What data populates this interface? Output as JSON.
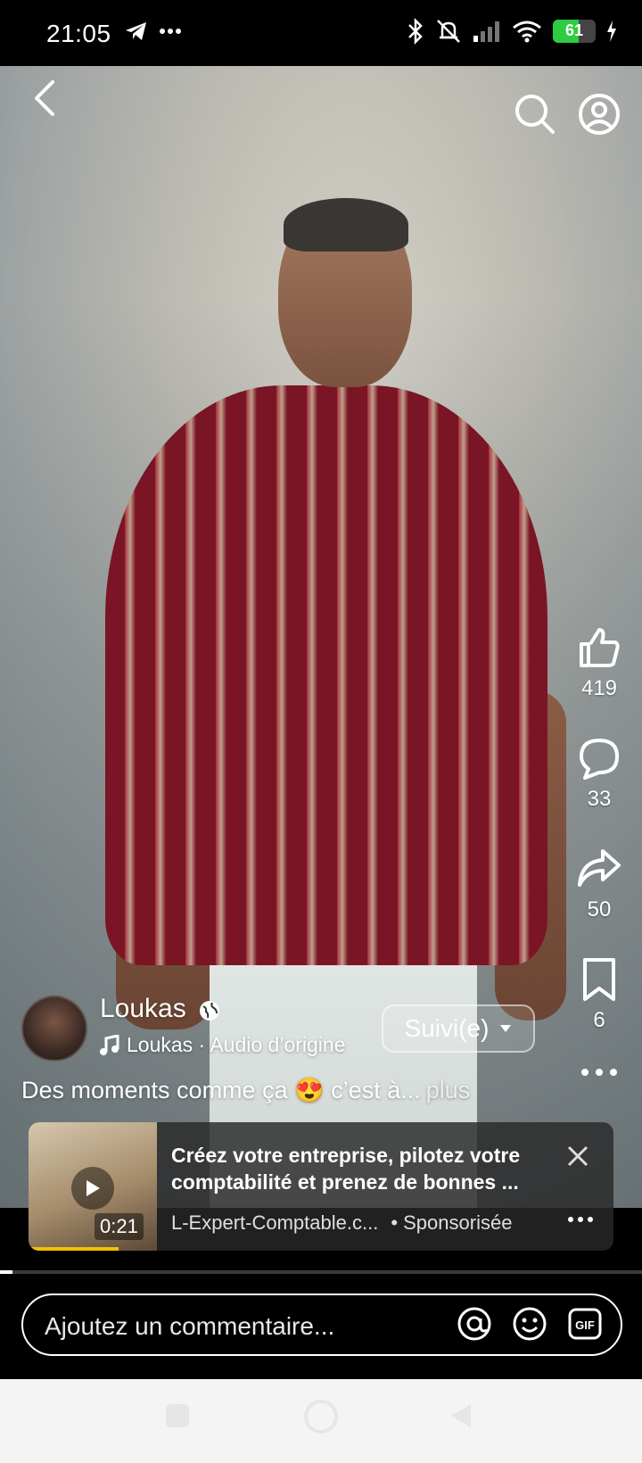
{
  "status": {
    "time": "21:05",
    "battery_percent": "61",
    "battery_level": 0.61
  },
  "video": {
    "likes": "419",
    "comments": "33",
    "shares": "50",
    "saves": "6",
    "progress_fraction": 0.02
  },
  "author": {
    "name": "Loukas",
    "audio": "Loukas · Audio d’origine",
    "follow_label": "Suivi(e)"
  },
  "caption": {
    "text": "Des moments comme ça 😍 c’est à...",
    "more": "plus"
  },
  "ad": {
    "title": "Créez votre entreprise, pilotez votre comptabilité et prenez de bonnes ...",
    "source": "L-Expert-Comptable.c...",
    "sponsored": "• Sponsorisée",
    "duration": "0:21",
    "progress_fraction": 0.7
  },
  "comment": {
    "placeholder": "Ajoutez un commentaire..."
  },
  "colors": {
    "battery": "#2ecc40",
    "ad_progress": "#f2c200"
  }
}
